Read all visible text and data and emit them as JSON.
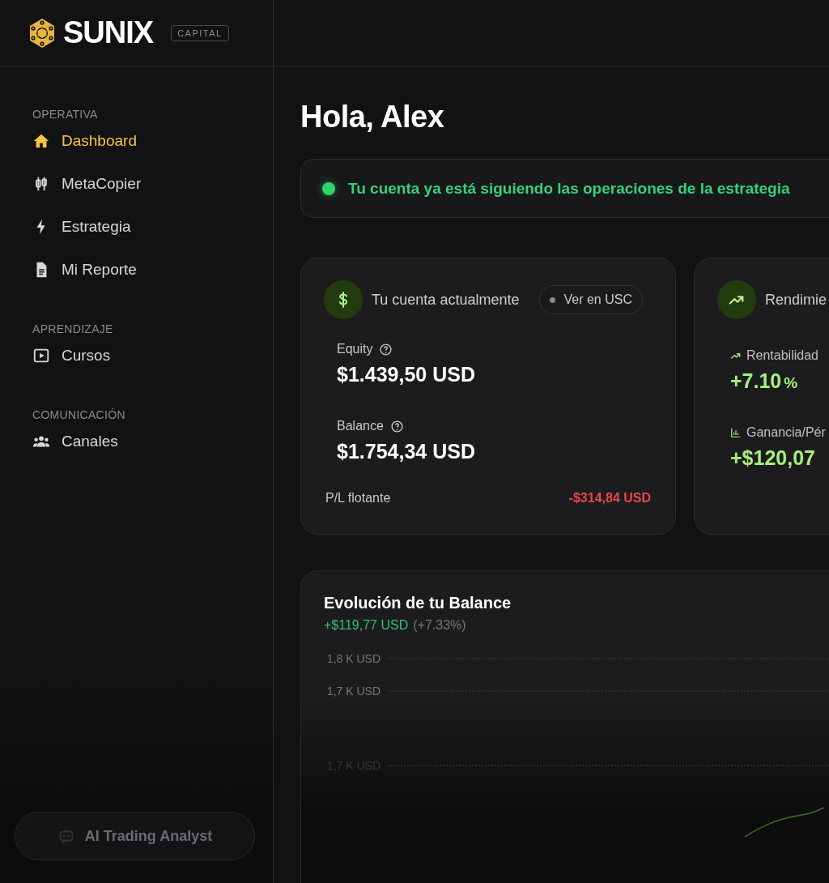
{
  "brand": {
    "name": "SUNIX",
    "tag": "CAPITAL"
  },
  "sidebar": {
    "sections": [
      {
        "title": "OPERATIVA",
        "items": [
          {
            "label": "Dashboard",
            "selected": true
          },
          {
            "label": "MetaCopier",
            "selected": false
          },
          {
            "label": "Estrategia",
            "selected": false
          },
          {
            "label": "Mi Reporte",
            "selected": false
          }
        ]
      },
      {
        "title": "APRENDIZAJE",
        "items": [
          {
            "label": "Cursos",
            "selected": false
          }
        ]
      },
      {
        "title": "COMUNICACIÓN",
        "items": [
          {
            "label": "Canales",
            "selected": false
          }
        ]
      }
    ],
    "assistant_button": "AI Trading Analyst"
  },
  "greeting": "Hola, Alex",
  "status_banner": {
    "text": "Tu cuenta ya está siguiendo las operaciones de la estrategia",
    "active": true
  },
  "account_card": {
    "title": "Tu cuenta actualmente",
    "toggle": "Ver en USC",
    "metrics": [
      {
        "label": "Equity",
        "value": "$1.439,50 USD"
      },
      {
        "label": "Balance",
        "value": "$1.754,34 USD"
      }
    ],
    "floating": {
      "label": "P/L flotante",
      "value": "-$314,84 USD"
    }
  },
  "performance_card": {
    "title": "Rendimie",
    "metrics": [
      {
        "label": "Rentabilidad",
        "value": "+7.10",
        "unit": "%"
      },
      {
        "label": "Ganancia/Pér",
        "value": "+$120,07"
      }
    ]
  },
  "balance_chart": {
    "title": "Evolución de tu Balance",
    "change": "+$119,77 USD",
    "change_pct": "(+7.33%)",
    "y_labels": [
      "1,8 K USD",
      "1,7 K USD",
      "1,7 K USD"
    ]
  }
}
